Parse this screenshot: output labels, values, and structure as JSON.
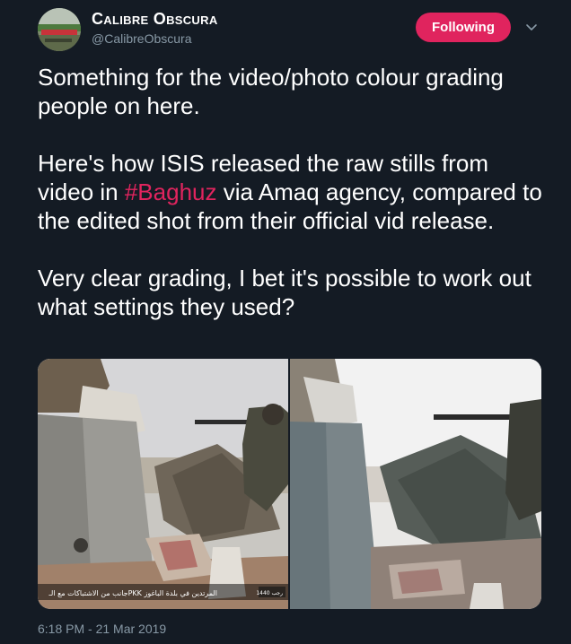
{
  "author": {
    "display_name": "Calibre Obscura",
    "handle": "@CalibreObscura",
    "avatar_icon": "avatar-image"
  },
  "follow_button": {
    "label": "Following",
    "color": "#e0245e"
  },
  "menu": {
    "icon": "chevron-down-icon"
  },
  "tweet": {
    "paragraph_1": "Something for the video/photo colour grading people on here.",
    "paragraph_2_before": "Here's how ISIS released the raw stills from video in ",
    "hashtag": "#Baghuz",
    "paragraph_2_after": " via Amaq agency, compared to the edited shot from their official vid release.",
    "paragraph_3": "Very clear grading, I bet it's possible to work out what settings they used?"
  },
  "media": {
    "left_caption": "جانب من الاشتباكات مع الـPKK المرتدين في بلدة الباغوز",
    "left_badge": "1440 رجب"
  },
  "timestamp": "6:18 PM - 21 Mar 2019",
  "colors": {
    "background": "#141b24",
    "text": "#ffffff",
    "secondary_text": "#8899a6",
    "accent": "#e0245e"
  }
}
